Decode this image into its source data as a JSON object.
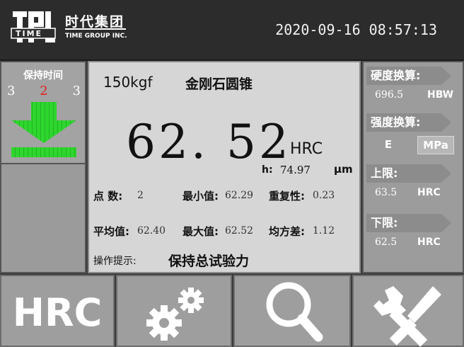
{
  "header": {
    "brand_cn": "时代集团",
    "brand_en": "TIME GROUP INC.",
    "logo_text": "TIME",
    "datetime": "2020-09-16 08:57:13"
  },
  "hold": {
    "title": "保持时间",
    "countdown": [
      "3",
      "2",
      "3"
    ]
  },
  "measure": {
    "load": "150kgf",
    "indenter": "金刚石圆锥",
    "value": "62. 52",
    "scale": "HRC",
    "h_label": "h:",
    "h_value": "74.97",
    "h_unit": "μm"
  },
  "stats": {
    "count_label": "点 数:",
    "count": "2",
    "min_label": "最小值:",
    "min": "62.29",
    "repeat_label": "重复性:",
    "repeat": "0.23",
    "avg_label": "平均值:",
    "avg": "62.40",
    "max_label": "最大值:",
    "max": "62.52",
    "std_label": "均方差:",
    "std": "1.12"
  },
  "tip": {
    "label": "操作提示:",
    "value": "保持总试验力"
  },
  "right": {
    "hardness_conv_title": "硬度换算:",
    "hardness_conv_value": "696.5",
    "hardness_conv_unit": "HBW",
    "strength_conv_title": "强度换算:",
    "strength_conv_e": "E",
    "strength_conv_unit": "MPa",
    "upper_title": "上限:",
    "upper_value": "63.5",
    "upper_unit": "HRC",
    "lower_title": "下限:",
    "lower_value": "62.5",
    "lower_unit": "HRC"
  },
  "bottom": {
    "scale_button": "HRC",
    "icons": [
      "gears-icon",
      "search-icon",
      "tools-icon"
    ]
  },
  "colors": {
    "accent_green": "#2ed62e",
    "active_red": "#e02020",
    "panel_gray": "#9c9c9c",
    "main_bg": "#d6d6d6"
  }
}
